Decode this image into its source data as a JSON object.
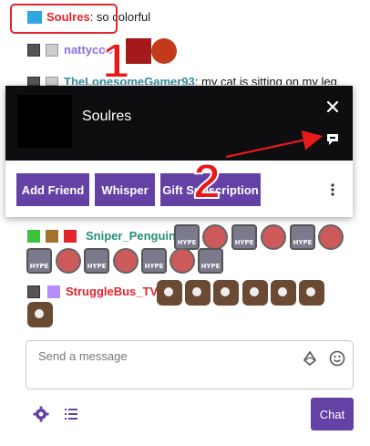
{
  "chat": {
    "messages": [
      {
        "username": "Soulres",
        "username_color": "#e3242b",
        "text": "so colorful"
      },
      {
        "username": "nattycoo",
        "username_color": "#8d6de0",
        "text": ""
      },
      {
        "username": "TheLonesomeGamer93",
        "username_color": "#3b8f9e",
        "text": "my cat is sitting on my leg"
      },
      {
        "username": "Sniper_Penguin",
        "username_color": "#2a8e7a",
        "text": ""
      },
      {
        "username": "StruggleBus_TV",
        "username_color": "#e3242b",
        "text": ""
      }
    ]
  },
  "user_card": {
    "display_name": "Soulres",
    "close_icon": "close-icon",
    "whisper_icon": "chat-bubble-icon",
    "buttons": {
      "add_friend": "Add Friend",
      "whisper": "Whisper",
      "gift_subscription": "Gift Subscription"
    },
    "more_icon": "more-vertical-icon"
  },
  "composer": {
    "placeholder": "Send a message",
    "chat_button": "Chat"
  },
  "annotations": {
    "marker_1": "1",
    "marker_2": "2"
  },
  "colors": {
    "accent": "#6441a5",
    "annotation": "#e8191b",
    "card_header": "#0e0e10"
  }
}
